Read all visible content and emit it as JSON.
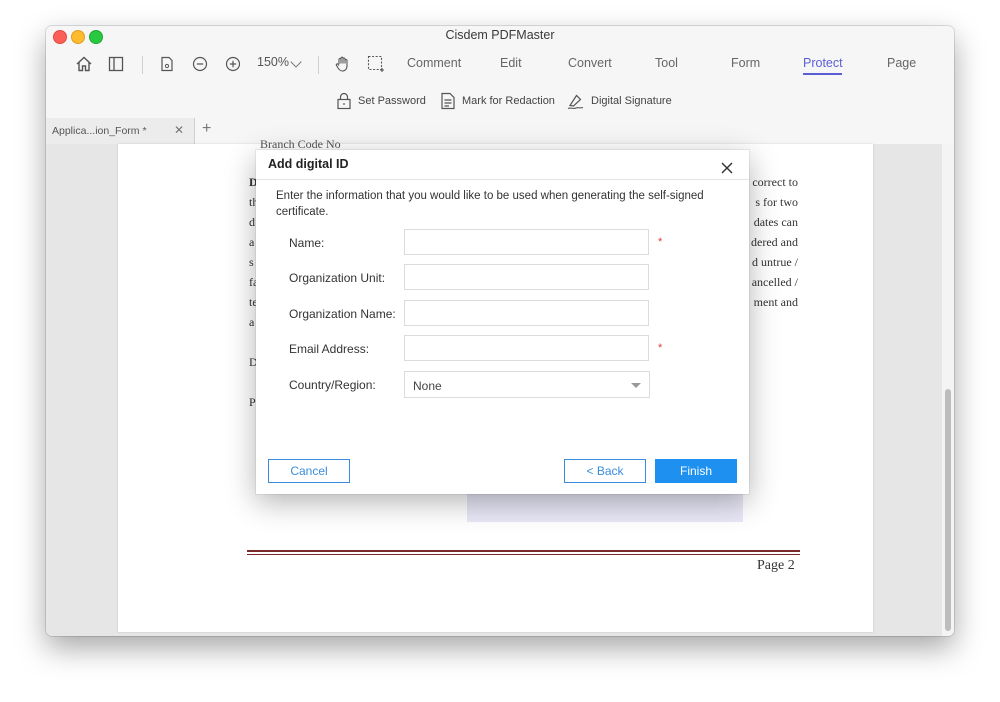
{
  "window": {
    "title": "Cisdem PDFMaster"
  },
  "toolbar": {
    "zoom": "150%",
    "menus": [
      "Comment",
      "Edit",
      "Convert",
      "Tool",
      "Form",
      "Protect",
      "Page"
    ],
    "active_menu": "Protect",
    "sub_actions": [
      "Set Password",
      "Mark for Redaction",
      "Digital Signature"
    ]
  },
  "tabs": [
    {
      "label": "Applica...ion_Form *"
    }
  ],
  "document": {
    "fragment_top": "Branch Code No",
    "left_letters": [
      "D",
      "th",
      "d",
      "a",
      "s",
      "fa",
      "te",
      "a",
      "D",
      "P"
    ],
    "right_fragments": [
      "correct to",
      "s for two",
      "dates can",
      "dered and",
      "d untrue /",
      "ancelled /",
      "ment and"
    ],
    "page_label": "Page 2",
    "accent": "#7a2a2a"
  },
  "dialog": {
    "title": "Add digital ID",
    "description": "Enter the information that you would like to be used when generating the self-signed certificate.",
    "fields": [
      {
        "label": "Name:",
        "value": "",
        "required": true
      },
      {
        "label": "Organization Unit:",
        "value": "",
        "required": false
      },
      {
        "label": "Organization Name:",
        "value": "",
        "required": false
      },
      {
        "label": "Email Address:",
        "value": "",
        "required": true
      }
    ],
    "country": {
      "label": "Country/Region:",
      "value": "None"
    },
    "required_mark": "*",
    "buttons": {
      "cancel": "Cancel",
      "back": "< Back",
      "finish": "Finish"
    },
    "colors": {
      "primary": "#1e90f0",
      "required": "#e53935"
    }
  },
  "icons": [
    "home-icon",
    "sidebar-icon",
    "page-icon",
    "zoom-out-icon",
    "zoom-in-icon",
    "chevron-down-icon",
    "hand-icon",
    "selection-icon",
    "lock-icon",
    "redact-icon",
    "signature-icon",
    "close-icon",
    "plus-icon"
  ]
}
